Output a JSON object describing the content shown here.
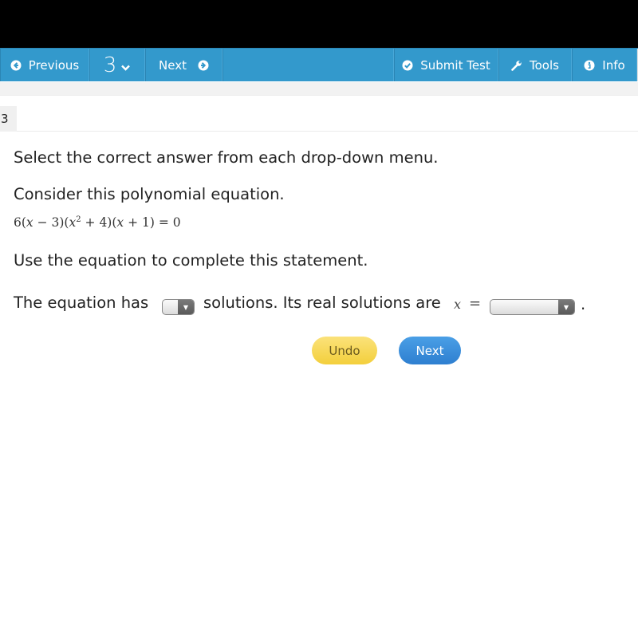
{
  "toolbar": {
    "previous_label": "Previous",
    "question_number": "3",
    "next_label": "Next",
    "submit_label": "Submit Test",
    "tools_label": "Tools",
    "info_label": "Info",
    "colors": {
      "toolbar_bg": "#3399cc",
      "icon": "#ffffff"
    }
  },
  "question": {
    "number": "3",
    "instruction": "Select the correct answer from each drop-down menu.",
    "prompt": "Consider this polynomial equation.",
    "equation": {
      "coef": "6(",
      "x1": "x",
      "p1": " − 3)(",
      "x2": "x",
      "exp": "2",
      "p2": " + 4)(",
      "x3": "x",
      "p3": " + 1)  =  0"
    },
    "task": "Use the equation to complete this statement.",
    "statement": {
      "part1": "The equation has",
      "part2": "solutions. Its real solutions are",
      "var": "x",
      "eq": "=",
      "end": "."
    },
    "dropdown1": {
      "selected": ""
    },
    "dropdown2": {
      "selected": ""
    }
  },
  "actions": {
    "undo_label": "Undo",
    "next_label": "Next",
    "colors": {
      "undo": "#f5d54a",
      "next": "#3a8ddb"
    }
  }
}
